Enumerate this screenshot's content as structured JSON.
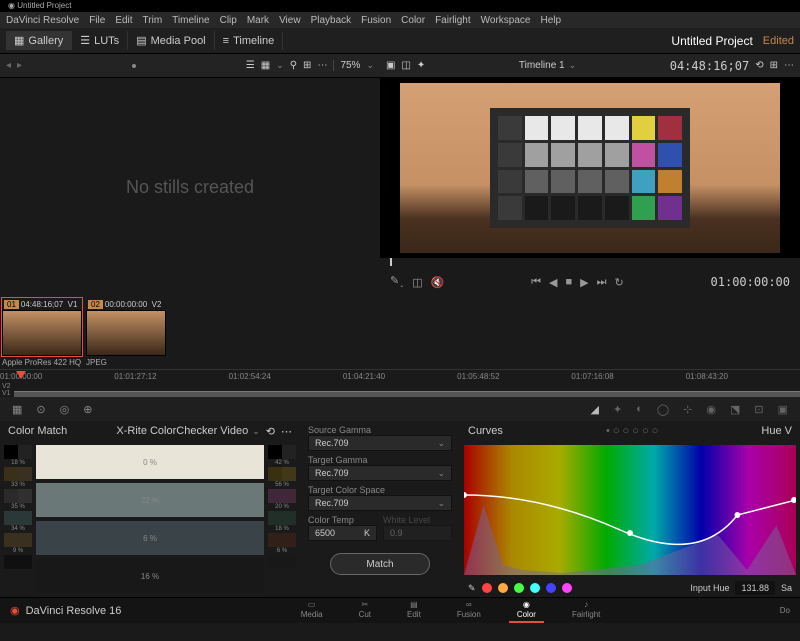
{
  "window_title": "Untitled Project",
  "menu": [
    "DaVinci Resolve",
    "File",
    "Edit",
    "Trim",
    "Timeline",
    "Clip",
    "Mark",
    "View",
    "Playback",
    "Fusion",
    "Color",
    "Fairlight",
    "Workspace",
    "Help"
  ],
  "toolbar": {
    "gallery": "Gallery",
    "luts": "LUTs",
    "media_pool": "Media Pool",
    "timeline": "Timeline"
  },
  "project": {
    "name": "Untitled Project",
    "status": "Edited"
  },
  "left_pane": {
    "zoom": "75%",
    "empty_text": "No stills created"
  },
  "right_pane": {
    "timeline_name": "Timeline 1",
    "timecode": "04:48:16;07"
  },
  "transport": {
    "current_tc": "01:00:00:00"
  },
  "clips": [
    {
      "num": "01",
      "tc": "04:48:16;07",
      "track": "V1",
      "format": "Apple ProRes 422 HQ"
    },
    {
      "num": "02",
      "tc": "00:00:00:00",
      "track": "V2",
      "format": "JPEG"
    }
  ],
  "ruler": [
    "01:00:00:00",
    "01:01:27:12",
    "01:02:54:24",
    "01:04:21:40",
    "01:05:48:52",
    "01:07:16:08",
    "01:08:43:20"
  ],
  "track_labels": [
    "V2",
    "V1"
  ],
  "colormatch": {
    "title": "Color Match",
    "chart_type": "X-Rite ColorChecker Video",
    "left_pcts": [
      "18 %",
      "33 %",
      "35 %",
      "34 %",
      "9 %"
    ],
    "bars": [
      "0 %",
      "22 %",
      "6 %",
      "16 %"
    ],
    "right_pcts": [
      "42 %",
      "56 %",
      "20 %",
      "18 %",
      "6 %"
    ]
  },
  "settings": {
    "source_gamma": {
      "label": "Source Gamma",
      "value": "Rec.709"
    },
    "target_gamma": {
      "label": "Target Gamma",
      "value": "Rec.709"
    },
    "target_colorspace": {
      "label": "Target Color Space",
      "value": "Rec.709"
    },
    "color_temp": {
      "label": "Color Temp",
      "value": "6500",
      "unit": "K"
    },
    "white_level": {
      "label": "White Level",
      "value": "0.9"
    },
    "match_btn": "Match"
  },
  "curves": {
    "title": "Curves",
    "right_tab": "Hue V",
    "input_hue_label": "Input Hue",
    "input_hue_value": "131.88",
    "sat_label": "Sa"
  },
  "pager": {
    "brand": "DaVinci Resolve 16",
    "tabs": [
      "Media",
      "Cut",
      "Edit",
      "Fusion",
      "Color",
      "Fairlight"
    ],
    "active": "Color",
    "right": "Do"
  },
  "colorchecker_cells": [
    "#3a3a3a",
    "#e8e8e8",
    "#e8e8e8",
    "#e8e8e8",
    "#e8e8e8",
    "#e0d040",
    "#a03040",
    "#3a3a3a",
    "#a0a0a0",
    "#a0a0a0",
    "#a0a0a0",
    "#a0a0a0",
    "#c050a0",
    "#3050b0",
    "#3a3a3a",
    "#606060",
    "#606060",
    "#606060",
    "#606060",
    "#40a0c0",
    "#c08030",
    "#3a3a3a",
    "#1a1a1a",
    "#1a1a1a",
    "#1a1a1a",
    "#1a1a1a",
    "#30a050",
    "#703090"
  ],
  "cm_swatches_left": [
    [
      "#000",
      "#222"
    ],
    [
      "#3a301a",
      "#3a3020"
    ],
    [
      "#2a2a2a",
      "#303030"
    ],
    [
      "#2a3838",
      "#2a3838"
    ],
    [
      "#3a3020",
      "#3a3020"
    ],
    [
      "#101010",
      "#101010"
    ]
  ],
  "cm_swatches_right": [
    [
      "#000",
      "#222"
    ],
    [
      "#383010",
      "#403818"
    ],
    [
      "#402838",
      "#402838"
    ],
    [
      "#203028",
      "#203028"
    ],
    [
      "#302018",
      "#302018"
    ],
    [
      "#181818",
      "#181818"
    ]
  ],
  "cm_bar_colors": [
    "#e8e4d8",
    "#6a7878",
    "#3a4448",
    "#181818"
  ]
}
